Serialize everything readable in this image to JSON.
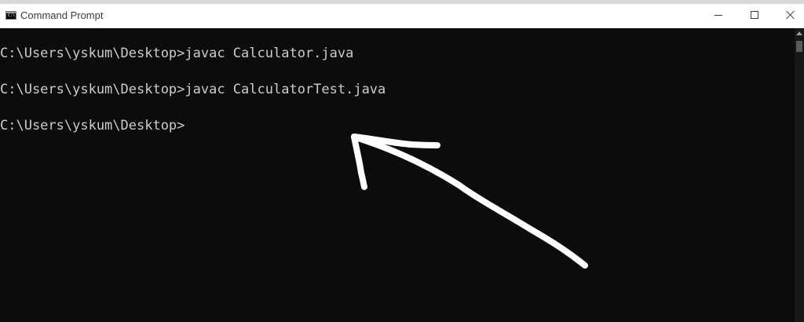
{
  "window": {
    "title": "Command Prompt",
    "icon": "cmd-icon",
    "icon_text": "C:\\"
  },
  "controls": {
    "minimize": "minimize-icon",
    "maximize": "maximize-icon",
    "close": "close-icon"
  },
  "console": {
    "lines": [
      "C:\\Users\\yskum\\Desktop>javac Calculator.java",
      "C:\\Users\\yskum\\Desktop>javac CalculatorTest.java",
      "C:\\Users\\yskum\\Desktop>"
    ]
  },
  "colors": {
    "console_bg": "#0c0c0c",
    "console_text": "#cccccc",
    "annotation_stroke": "#ffffff"
  },
  "annotation": {
    "icon": "hand-drawn-arrow-icon"
  }
}
